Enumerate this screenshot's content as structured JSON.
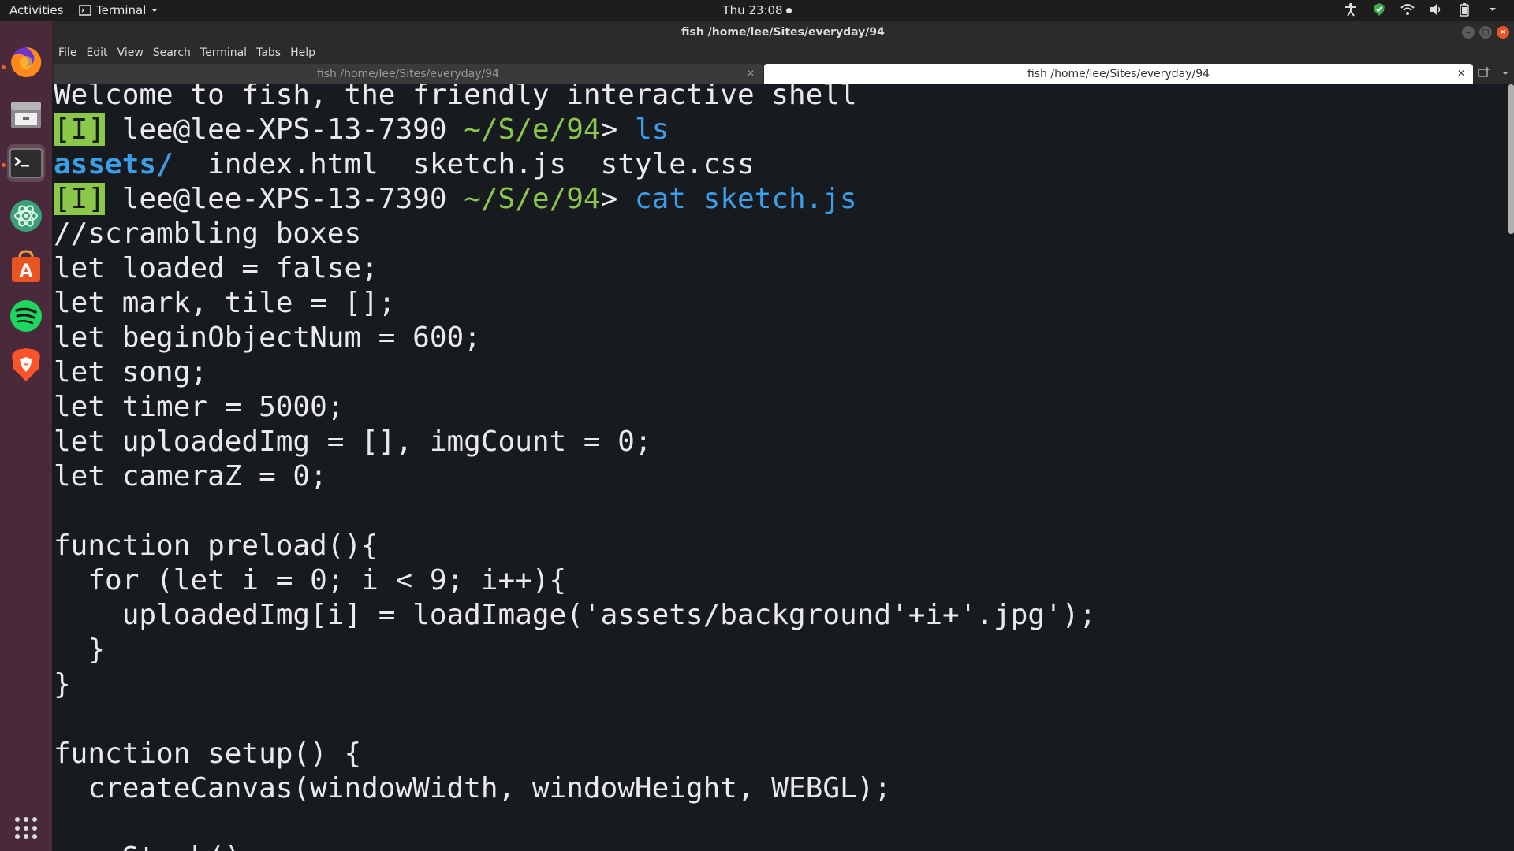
{
  "topbar": {
    "activities": "Activities",
    "app_name": "Terminal",
    "clock": "Thu 23:08"
  },
  "dock": {
    "items": [
      {
        "name": "firefox-icon"
      },
      {
        "name": "files-icon"
      },
      {
        "name": "terminal-icon"
      },
      {
        "name": "atom-icon"
      },
      {
        "name": "software-icon"
      },
      {
        "name": "spotify-icon"
      },
      {
        "name": "brave-icon"
      }
    ]
  },
  "window": {
    "title": "fish /home/lee/Sites/everyday/94"
  },
  "menubar": {
    "file": "File",
    "edit": "Edit",
    "view": "View",
    "search": "Search",
    "terminal": "Terminal",
    "tabs": "Tabs",
    "help": "Help"
  },
  "tabs": [
    {
      "label": "fish /home/lee/Sites/everyday/94",
      "active": false
    },
    {
      "label": "fish /home/lee/Sites/everyday/94",
      "active": true
    }
  ],
  "terminal": {
    "welcome": "Welcome to fish, the friendly interactive shell",
    "badge": "[I]",
    "user_host": " lee@lee-XPS-13-7390 ",
    "cwd": "~/S/e/94",
    "prompt_char": "> ",
    "cmd1": "ls",
    "ls_dir": "assets/",
    "ls_files": "  index.html  sketch.js  style.css",
    "cmd2_a": "cat",
    "cmd2_b": " sketch.js",
    "code": [
      "//scrambling boxes",
      "let loaded = false;",
      "let mark, tile = [];",
      "let beginObjectNum = 600;",
      "let song;",
      "let timer = 5000;",
      "let uploadedImg = [], imgCount = 0;",
      "let cameraZ = 0;",
      "",
      "function preload(){",
      "  for (let i = 0; i < 9; i++){",
      "    uploadedImg[i] = loadImage('assets/background'+i+'.jpg');",
      "  }",
      "}",
      "",
      "function setup() {",
      "  createCanvas(windowWidth, windowHeight, WEBGL);",
      "",
      "    Stack()"
    ]
  }
}
